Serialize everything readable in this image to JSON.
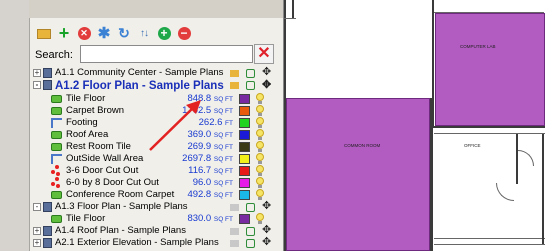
{
  "panel": {
    "header_text": "",
    "search": {
      "label": "Search:",
      "value": "",
      "placeholder": ""
    }
  },
  "toolbar": {
    "icons": [
      "folder-icon",
      "add-icon",
      "delete-icon",
      "settings-icon",
      "refresh-icon",
      "sort-icon",
      "expand-icon",
      "collapse-icon"
    ]
  },
  "tree": {
    "plans": [
      {
        "label": "A1.1 Community Center - Sample Plans",
        "expander": "+",
        "active": false
      },
      {
        "label": "A1.2 Floor Plan - Sample Plans",
        "expander": "-",
        "active": true
      },
      {
        "label": "A1.3 Floor Plan - Sample Plans",
        "expander": "-",
        "active": false
      },
      {
        "label": "A1.4 Roof Plan - Sample Plans",
        "expander": "+",
        "active": false
      },
      {
        "label": "A2.1 Exterior Elevation - Sample Plans",
        "expander": "+",
        "active": false
      }
    ],
    "conditions": [
      {
        "label": "Tile Floor",
        "qty": "848.8",
        "unit": "SQ FT",
        "type": "area",
        "color": "#7a2aa0"
      },
      {
        "label": "Carpet Brown",
        "qty": "1702.5",
        "unit": "SQ FT",
        "type": "area",
        "color": "#e85a0c"
      },
      {
        "label": "Footing",
        "qty": "262.6",
        "unit": "FT",
        "type": "linear",
        "color": "#22d422"
      },
      {
        "label": "Roof Area",
        "qty": "369.0",
        "unit": "SQ FT",
        "type": "area",
        "color": "#1a1ad8"
      },
      {
        "label": "Rest Room Tile",
        "qty": "269.9",
        "unit": "SQ FT",
        "type": "area",
        "color": "#3a3a14"
      },
      {
        "label": "OutSide Wall Area",
        "qty": "2697.8",
        "unit": "SQ FT",
        "type": "linear",
        "color": "#f2f21a"
      },
      {
        "label": "3-6 Door Cut Out",
        "qty": "116.7",
        "unit": "SQ FT",
        "type": "count",
        "color": "#e81a1a"
      },
      {
        "label": "6-0 by 8 Door Cut Out",
        "qty": "96.0",
        "unit": "SQ FT",
        "type": "count",
        "color": "#e81ae8"
      },
      {
        "label": "Conference Room Carpet",
        "qty": "492.8",
        "unit": "SQ FT",
        "type": "area",
        "color": "#1ab8e8"
      },
      {
        "label": "Tile Floor",
        "qty": "830.0",
        "unit": "SQ FT",
        "type": "area",
        "color": "#7a2aa0"
      }
    ]
  },
  "canvas": {
    "rooms": [
      "COMPUTER LAB",
      "COMMON ROOM",
      "OFFICE"
    ]
  }
}
